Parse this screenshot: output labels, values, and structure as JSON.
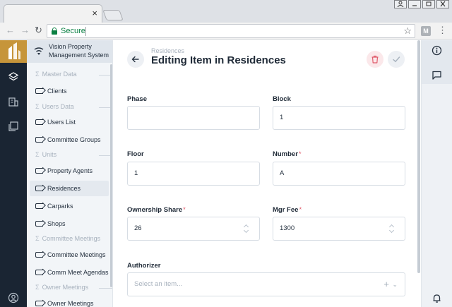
{
  "browser": {
    "close_glyph": "×",
    "address_secure": "Secure",
    "extension_letter": "M"
  },
  "app": {
    "name": "Vision Property Management System"
  },
  "sidebar": {
    "groups": [
      {
        "label": "Master Data"
      },
      {
        "label": "Users Data"
      },
      {
        "label": "Units"
      },
      {
        "label": "Committee Meetings"
      },
      {
        "label": "Owner Meetings"
      }
    ],
    "items": [
      {
        "label": "Clients"
      },
      {
        "label": "Users List"
      },
      {
        "label": "Committee Groups"
      },
      {
        "label": "Property Agents"
      },
      {
        "label": "Residences"
      },
      {
        "label": "Carparks"
      },
      {
        "label": "Shops"
      },
      {
        "label": "Committee Meetings"
      },
      {
        "label": "Comm Meet Agendas"
      },
      {
        "label": "Owner Meetings"
      }
    ],
    "active_item": "Residences"
  },
  "header": {
    "breadcrumb": "Residences",
    "title": "Editing Item in Residences"
  },
  "form": {
    "phase": {
      "label": "Phase",
      "value": ""
    },
    "block": {
      "label": "Block",
      "value": "1"
    },
    "floor": {
      "label": "Floor",
      "value": "1"
    },
    "number": {
      "label": "Number",
      "value": "A",
      "required": "*"
    },
    "ownership_share": {
      "label": "Ownership Share",
      "value": "26",
      "required": "*"
    },
    "mgr_fee": {
      "label": "Mgr Fee",
      "value": "1300",
      "required": "*"
    },
    "authorizer": {
      "label": "Authorizer",
      "placeholder": "Select an item..."
    }
  },
  "colors": {
    "rail": "#1a2533",
    "logo": "#c6953a",
    "accent": "#e05a6a"
  }
}
